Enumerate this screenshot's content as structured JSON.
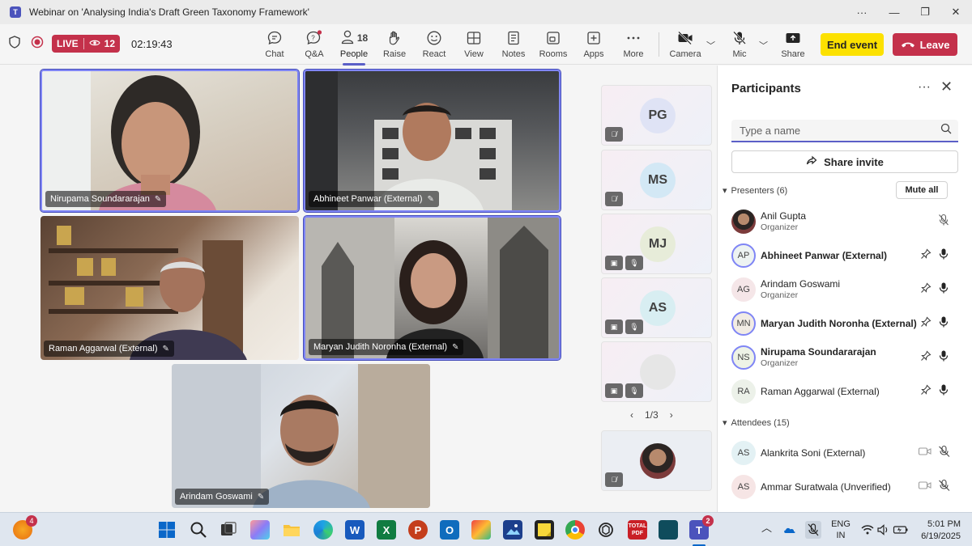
{
  "window": {
    "title": "Webinar on 'Analysing India's Draft Green Taxonomy Framework'"
  },
  "meeting": {
    "live_label": "LIVE",
    "viewer_count": "12",
    "elapsed": "02:19:43",
    "people_count": "18"
  },
  "toolbar": {
    "chat": "Chat",
    "qa": "Q&A",
    "people": "People",
    "raise": "Raise",
    "react": "React",
    "view": "View",
    "notes": "Notes",
    "rooms": "Rooms",
    "apps": "Apps",
    "more": "More",
    "camera": "Camera",
    "mic": "Mic",
    "share": "Share",
    "end_event": "End event",
    "leave": "Leave"
  },
  "stage": {
    "tiles": [
      {
        "name": "Nirupama Soundararajan"
      },
      {
        "name": "Abhineet Panwar (External)"
      },
      {
        "name": "Raman Aggarwal (External)"
      },
      {
        "name": "Maryan Judith Noronha (External)"
      },
      {
        "name": "Arindam Goswami"
      }
    ],
    "side": [
      {
        "initials": "PG"
      },
      {
        "initials": "MS"
      },
      {
        "initials": "MJ"
      },
      {
        "initials": "AS"
      },
      {
        "initials": ""
      }
    ],
    "pager": "1/3"
  },
  "panel": {
    "title": "Participants",
    "search_placeholder": "Type a name",
    "share_invite": "Share invite",
    "presenters_header": "Presenters (6)",
    "mute_all": "Mute all",
    "attendees_header": "Attendees (15)",
    "presenters": [
      {
        "initials": "",
        "name": "Anil Gupta",
        "role": "Organizer"
      },
      {
        "initials": "AP",
        "name": "Abhineet Panwar (External)",
        "role": ""
      },
      {
        "initials": "AG",
        "name": "Arindam Goswami",
        "role": "Organizer"
      },
      {
        "initials": "MN",
        "name": "Maryan Judith Noronha (External)",
        "role": ""
      },
      {
        "initials": "NS",
        "name": "Nirupama Soundararajan",
        "role": "Organizer"
      },
      {
        "initials": "RA",
        "name": "Raman Aggarwal (External)",
        "role": ""
      }
    ],
    "attendees": [
      {
        "initials": "AS",
        "name": "Alankrita Soni (External)"
      },
      {
        "initials": "AS",
        "name": "Ammar Suratwala (Unverified)"
      }
    ]
  },
  "taskbar": {
    "weather_badge": "4",
    "teams_badge": "2",
    "lang_line1": "ENG",
    "lang_line2": "IN",
    "time": "5:01 PM",
    "date": "6/19/2025",
    "total_pdf_line1": "TOTAL",
    "total_pdf_line2": "PDF"
  },
  "colors": {
    "accent": "#5b5fc7",
    "live_red": "#c4314b",
    "end_yellow": "#fce100"
  }
}
